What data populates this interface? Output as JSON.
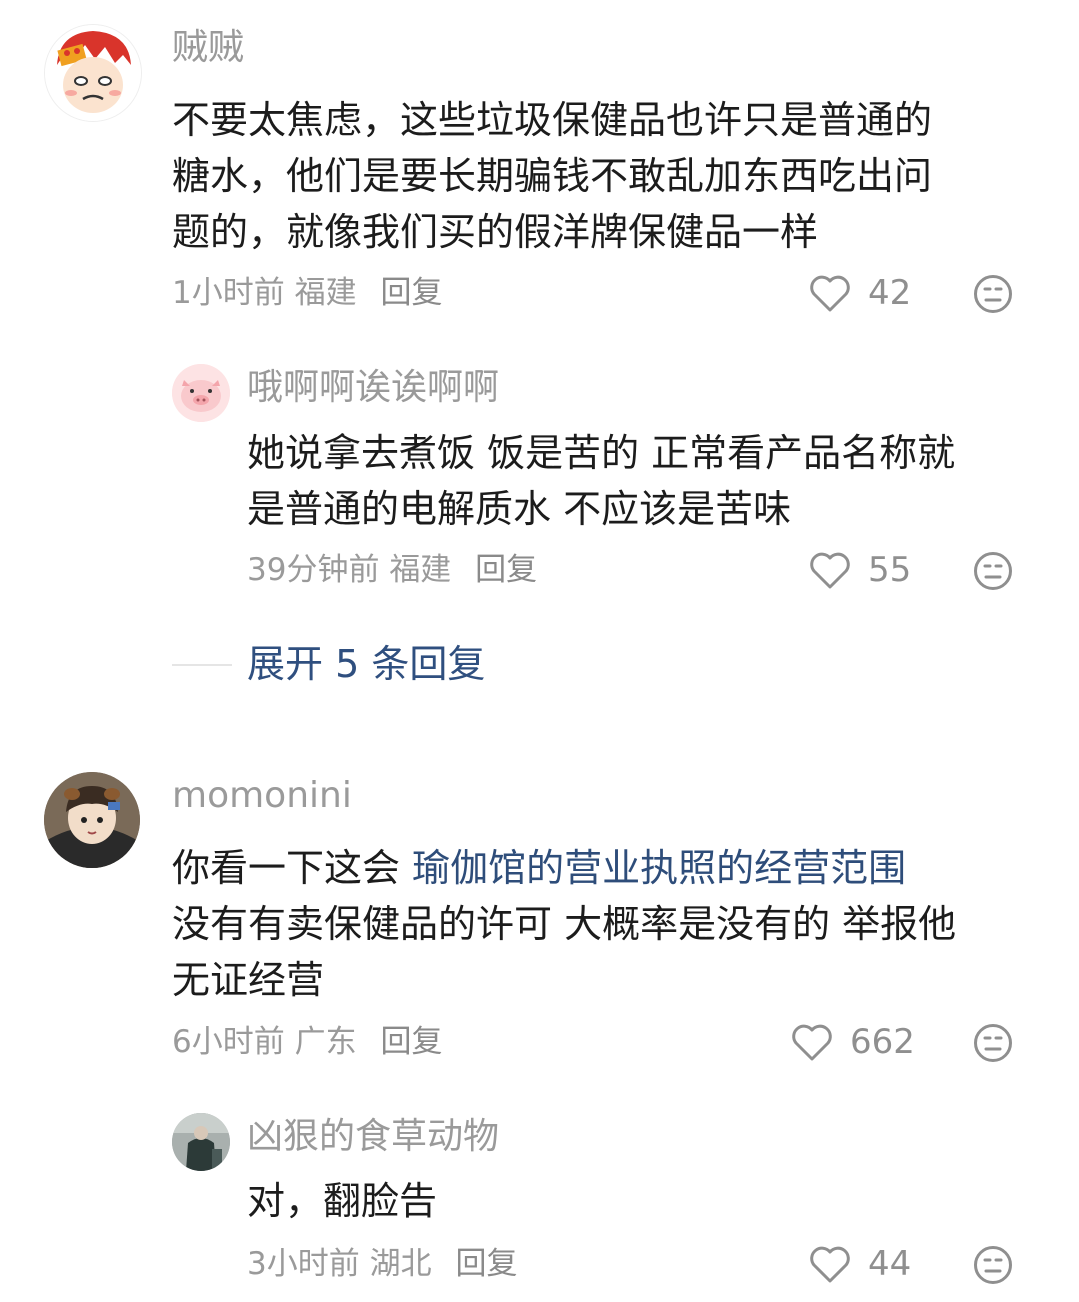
{
  "comments": [
    {
      "username": "贼贼",
      "lines": [
        "不要太焦虑，这些垃圾保健品也许只是普通的",
        "糖水，他们是要长期骗钱不敢乱加东西吃出问",
        "题的，就像我们买的假洋牌保健品一样"
      ],
      "time": "1小时前",
      "location": "福建",
      "reply_label": "回复",
      "likes": "42",
      "replies": [
        {
          "username": "哦啊啊诶诶啊啊",
          "lines": [
            "她说拿去煮饭 饭是苦的 正常看产品名称就",
            "是普通的电解质水 不应该是苦味"
          ],
          "time": "39分钟前",
          "location": "福建",
          "reply_label": "回复",
          "likes": "55"
        }
      ],
      "expand_label": "展开 5 条回复"
    },
    {
      "username": "momonini",
      "line1_prefix": "你看一下这会 ",
      "line1_link": "瑜伽馆的营业执照的经营范围",
      "lines_rest": [
        "没有有卖保健品的许可 大概率是没有的 举报他",
        "无证经营"
      ],
      "time": "6小时前",
      "location": "广东",
      "reply_label": "回复",
      "likes": "662",
      "replies": [
        {
          "username": "凶狠的食草动物",
          "lines": [
            "对，翻脸告"
          ],
          "time": "3小时前",
          "location": "湖北",
          "reply_label": "回复",
          "likes": "44"
        }
      ]
    }
  ],
  "icons": {
    "like": "heart-outline-icon",
    "dislike": "meh-face-icon"
  },
  "colors": {
    "link": "#2e4d7a",
    "meta": "#9a9a9a",
    "text": "#1c1c1c"
  }
}
